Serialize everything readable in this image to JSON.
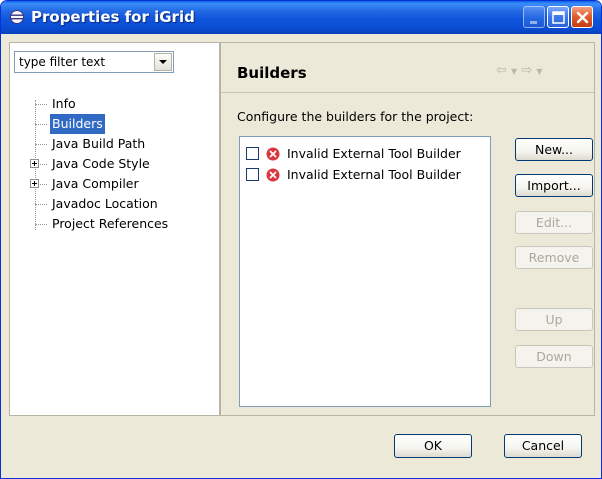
{
  "window": {
    "title": "Properties for iGrid"
  },
  "filter": {
    "value": "type filter text"
  },
  "tree": {
    "items": [
      {
        "label": "Info",
        "expandable": false,
        "selected": false
      },
      {
        "label": "Builders",
        "expandable": false,
        "selected": true
      },
      {
        "label": "Java Build Path",
        "expandable": false,
        "selected": false
      },
      {
        "label": "Java Code Style",
        "expandable": true,
        "selected": false
      },
      {
        "label": "Java Compiler",
        "expandable": true,
        "selected": false
      },
      {
        "label": "Javadoc Location",
        "expandable": false,
        "selected": false
      },
      {
        "label": "Project References",
        "expandable": false,
        "selected": false
      }
    ]
  },
  "page": {
    "title": "Builders",
    "description": "Configure the builders for the project:",
    "builders": [
      {
        "label": "Invalid External Tool Builder",
        "checked": false,
        "icon": "error-icon"
      },
      {
        "label": "Invalid External Tool Builder",
        "checked": false,
        "icon": "error-icon"
      }
    ],
    "buttons": {
      "new": {
        "label": "New...",
        "enabled": true
      },
      "import": {
        "label": "Import...",
        "enabled": true
      },
      "edit": {
        "label": "Edit...",
        "enabled": false
      },
      "remove": {
        "label": "Remove",
        "enabled": false
      },
      "up": {
        "label": "Up",
        "enabled": false
      },
      "down": {
        "label": "Down",
        "enabled": false
      }
    }
  },
  "footer": {
    "ok_label": "OK",
    "cancel_label": "Cancel"
  },
  "colors": {
    "titlebar": "#0a4bd1",
    "selection": "#316ac5",
    "dialog_bg": "#ece9d8",
    "error": "#d9363e"
  }
}
